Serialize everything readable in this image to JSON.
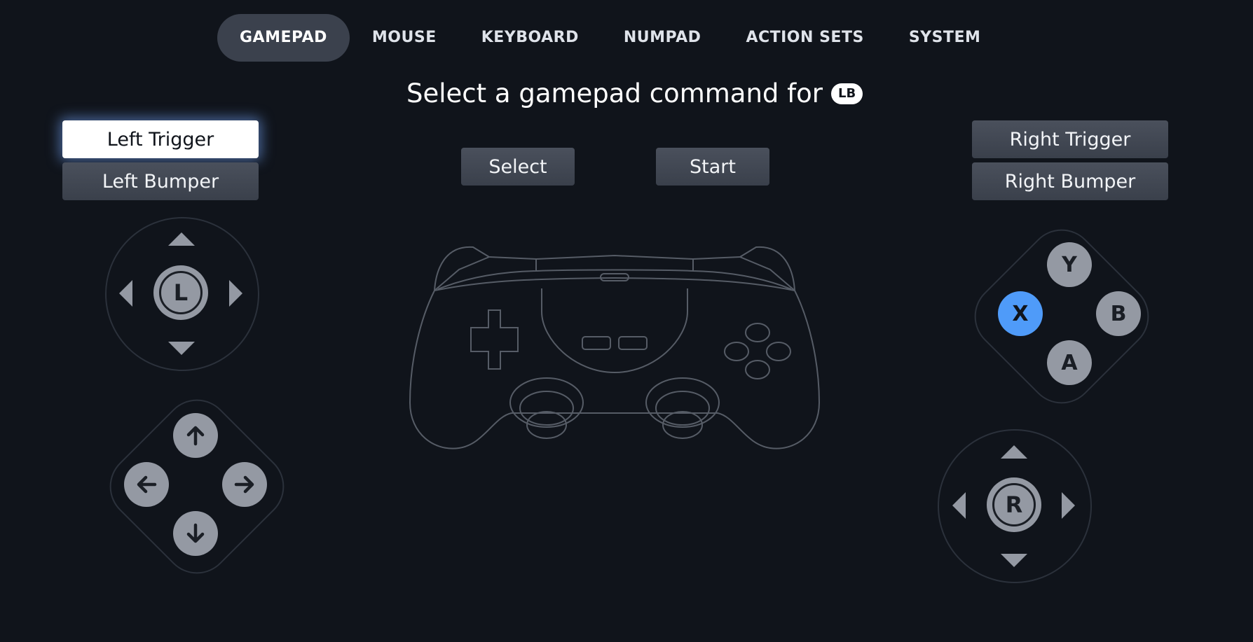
{
  "nav": {
    "tabs": [
      {
        "label": "GAMEPAD",
        "active": true
      },
      {
        "label": "MOUSE"
      },
      {
        "label": "KEYBOARD"
      },
      {
        "label": "NUMPAD"
      },
      {
        "label": "ACTION SETS"
      },
      {
        "label": "SYSTEM"
      }
    ]
  },
  "prompt": {
    "text": "Select a gamepad command for",
    "key": "LB"
  },
  "buttons": {
    "left_trigger": "Left Trigger",
    "left_bumper": "Left Bumper",
    "select": "Select",
    "start": "Start",
    "right_trigger": "Right Trigger",
    "right_bumper": "Right Bumper"
  },
  "left_stick": {
    "label": "L"
  },
  "right_stick": {
    "label": "R"
  },
  "face_buttons": {
    "y": "Y",
    "x": "X",
    "b": "B",
    "a": "A"
  },
  "icons": {
    "dpad": [
      "arrow-up-icon",
      "arrow-left-icon",
      "arrow-right-icon",
      "arrow-down-icon"
    ],
    "controller": "controller-outline-icon"
  },
  "colors": {
    "background": "#10141b",
    "button": "#3d434e",
    "button_focused": "#ffffff",
    "face_button": "#9499a3",
    "accent_blue": "#4f9bf9"
  }
}
